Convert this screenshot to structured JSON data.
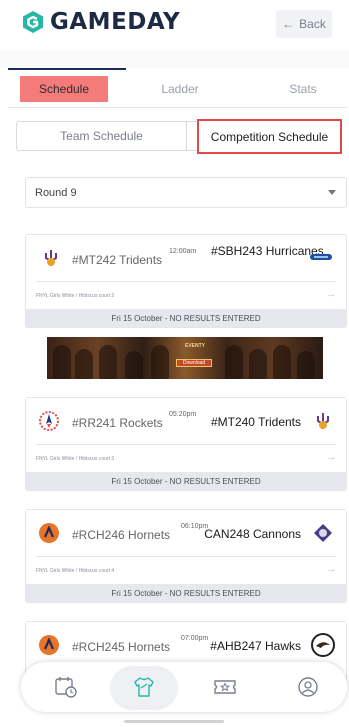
{
  "header": {
    "brand": "GAMEDAY",
    "back_label": "Back"
  },
  "tabs": [
    {
      "label": "Schedule",
      "active": true
    },
    {
      "label": "Ladder",
      "active": false
    },
    {
      "label": "Stats",
      "active": false
    }
  ],
  "schedule_toggle": {
    "team": "Team Schedule",
    "competition": "Competition Schedule",
    "selected": "competition"
  },
  "round_select": {
    "value": "Round 9"
  },
  "matches": [
    {
      "home": "#MT242 Tridents",
      "time": "12:00am",
      "away": "#SBH243 Hurricanes",
      "venue": "FNYL Girls White / Hibiscus court 2",
      "footer": "Fri 15 October - NO RESULTS ENTERED"
    },
    {
      "home": "#RR241 Rockets",
      "time": "05:20pm",
      "away": "#MT240 Tridents",
      "venue": "FNYL Girls White / Hibiscus court 3",
      "footer": "Fri 15 October - NO RESULTS ENTERED"
    },
    {
      "home": "#RCH246 Hornets",
      "time": "06:10pm",
      "away": "CAN248 Cannons",
      "venue": "FNYL Girls White / Hibiscus court 4",
      "footer": "Fri 15 October - NO RESULTS ENTERED"
    },
    {
      "home": "#RCH245 Hornets",
      "time": "07:00pm",
      "away": "#AHB247 Hawks"
    }
  ],
  "ad_banner": {
    "title": "EVENTY",
    "cta": "Download"
  },
  "bottom_nav": [
    {
      "icon": "calendar-clock-icon",
      "active": false
    },
    {
      "icon": "jersey-icon",
      "active": true
    },
    {
      "icon": "ticket-star-icon",
      "active": false
    },
    {
      "icon": "user-icon",
      "active": false
    }
  ],
  "colors": {
    "brand_navy": "#1e2a45",
    "active_tab": "#f47b79",
    "highlight_border": "#e04a4a",
    "footer_bg": "#e6e8ed"
  }
}
